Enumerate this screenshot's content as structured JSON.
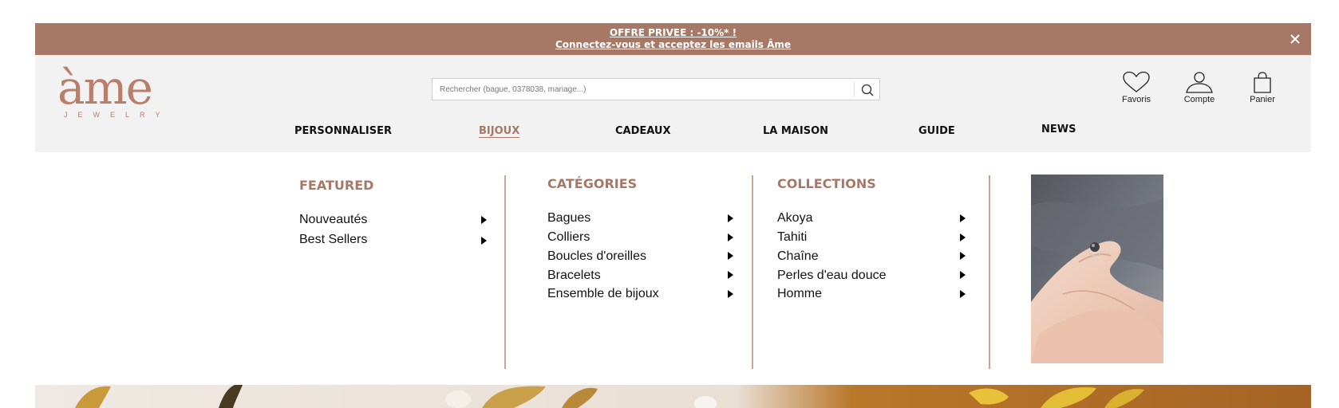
{
  "banner": {
    "line1": "OFFRE PRIVEE : -10%* !",
    "line2": "Connectez-vous et acceptez les emails Âme"
  },
  "logo": {
    "mark": "àme",
    "sub": "JEWELRY"
  },
  "search": {
    "placeholder": "Rechercher (bague, 0378038, mariage...)"
  },
  "header_icons": {
    "favorites": "Favoris",
    "account": "Compte",
    "cart": "Panier"
  },
  "nav": {
    "items": [
      {
        "label": "PERSONNALISER"
      },
      {
        "label": "BIJOUX",
        "active": true
      },
      {
        "label": "CADEAUX"
      },
      {
        "label": "LA MAISON"
      },
      {
        "label": "GUIDE"
      },
      {
        "label": "NEWS"
      }
    ]
  },
  "mega_menu": {
    "featured": {
      "title": "FEATURED",
      "items": [
        "Nouveautés",
        "Best Sellers"
      ]
    },
    "categories": {
      "title": "CATÉGORIES",
      "items": [
        "Bagues",
        "Colliers",
        "Boucles d'oreilles",
        "Bracelets",
        "Ensemble de bijoux"
      ]
    },
    "collections": {
      "title": "COLLECTIONS",
      "items": [
        "Akoya",
        "Tahiti",
        "Chaîne",
        "Perles d'eau douce",
        "Homme"
      ]
    }
  },
  "colors": {
    "accent": "#a87866",
    "banner_bg": "#a87866",
    "header_bg": "#f2f2f2",
    "divider": "#c8a68f"
  }
}
